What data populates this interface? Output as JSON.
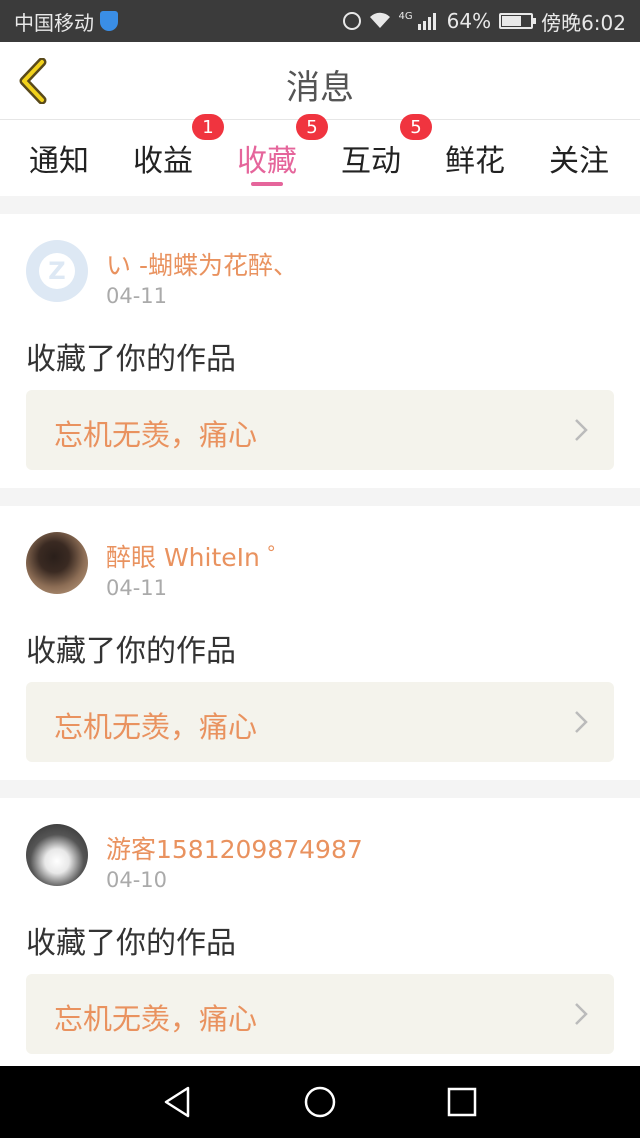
{
  "status_bar": {
    "carrier": "中国移动",
    "network": "4G",
    "battery": "64%",
    "time": "傍晚6:02"
  },
  "header": {
    "title": "消息"
  },
  "tabs": [
    {
      "label": "通知",
      "badge": null,
      "active": false
    },
    {
      "label": "收益",
      "badge": "1",
      "active": false
    },
    {
      "label": "收藏",
      "badge": "5",
      "active": true
    },
    {
      "label": "互动",
      "badge": "5",
      "active": false
    },
    {
      "label": "鲜花",
      "badge": null,
      "active": false
    },
    {
      "label": "关注",
      "badge": null,
      "active": false
    }
  ],
  "messages": [
    {
      "user": "い -蝴蝶为花醉、",
      "date": "04-11",
      "action": "收藏了你的作品",
      "work": "忘机无羡，痛心"
    },
    {
      "user": "醉眼 WhiteIn ゜",
      "date": "04-11",
      "action": "收藏了你的作品",
      "work": "忘机无羡，痛心"
    },
    {
      "user": "游客1581209874987",
      "date": "04-10",
      "action": "收藏了你的作品",
      "work": "忘机无羡，痛心"
    }
  ],
  "colors": {
    "accent_pink": "#e5659b",
    "name_orange": "#e9925f",
    "badge_red": "#f0343f"
  }
}
